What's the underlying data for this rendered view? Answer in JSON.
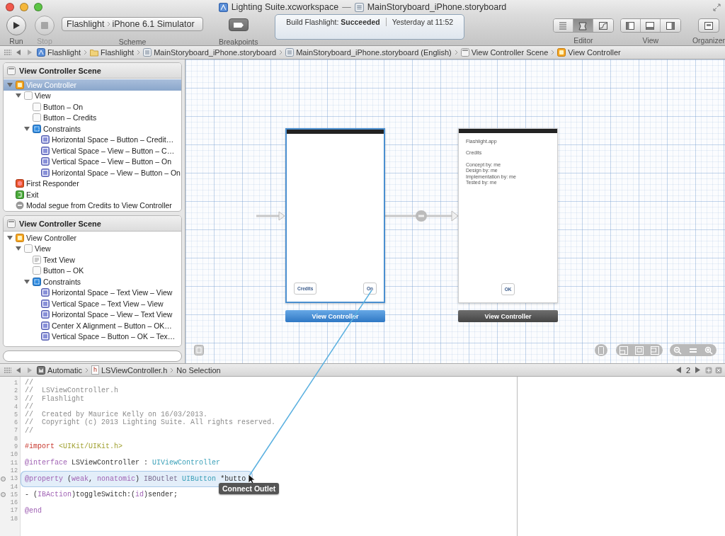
{
  "window": {
    "title": "Lighting Suite.xcworkspace",
    "separator": "—",
    "document": "MainStoryboard_iPhone.storyboard"
  },
  "toolbar": {
    "run": "Run",
    "stop": "Stop",
    "scheme": {
      "target": "Flashlight",
      "device": "iPhone 6.1 Simulator",
      "label": "Scheme"
    },
    "breakpoints": "Breakpoints",
    "activity": {
      "text": "Build Flashlight: **Succeeded**",
      "time": "Yesterday at 11:52"
    },
    "editor": {
      "label": "Editor",
      "segments": [
        {
          "kind": "standard",
          "selected": false
        },
        {
          "kind": "assistant",
          "selected": true
        },
        {
          "kind": "version",
          "selected": false
        }
      ]
    },
    "view": {
      "label": "View",
      "segments": [
        {
          "kind": "left"
        },
        {
          "kind": "bottom"
        },
        {
          "kind": "right"
        }
      ]
    },
    "organizer": "Organizer"
  },
  "jump_bar": [
    {
      "kind": "project",
      "label": "Flashlight"
    },
    {
      "kind": "folder",
      "label": "Flashlight"
    },
    {
      "kind": "storyboard",
      "label": "MainStoryboard_iPhone.storyboard"
    },
    {
      "kind": "storyboard",
      "label": "MainStoryboard_iPhone.storyboard (English)"
    },
    {
      "kind": "scene",
      "label": "View Controller Scene"
    },
    {
      "kind": "controller",
      "label": "View Controller"
    }
  ],
  "outline": [
    {
      "title": "View Controller Scene",
      "items": [
        {
          "kind": "controller",
          "label": "View Controller",
          "selected": true,
          "expanded": true,
          "children": [
            {
              "kind": "view",
              "label": "View",
              "selected": false,
              "expanded": true,
              "children": [
                {
                  "kind": "button",
                  "label": "Button – On",
                  "selected": false
                },
                {
                  "kind": "button",
                  "label": "Button – Credits",
                  "selected": false
                },
                {
                  "kind": "constraints",
                  "label": "Constraints",
                  "selected": false,
                  "expanded": true,
                  "children": [
                    {
                      "kind": "constraint",
                      "label": "Horizontal Space – Button – Credit…",
                      "selected": false
                    },
                    {
                      "kind": "constraint",
                      "label": "Vertical Space – View – Button – C…",
                      "selected": false
                    },
                    {
                      "kind": "constraint",
                      "label": "Vertical Space – View – Button – On",
                      "selected": false
                    },
                    {
                      "kind": "constraint",
                      "label": "Horizontal Space – View – Button – On",
                      "selected": false
                    }
                  ]
                }
              ]
            }
          ]
        },
        {
          "kind": "responder",
          "label": "First Responder",
          "selected": false
        },
        {
          "kind": "exit",
          "label": "Exit",
          "selected": false
        },
        {
          "kind": "segue",
          "label": "Modal segue from Credits to View Controller",
          "selected": false
        }
      ]
    },
    {
      "title": "View Controller Scene",
      "items": [
        {
          "kind": "controller",
          "label": "View Controller",
          "selected": false,
          "expanded": true,
          "children": [
            {
              "kind": "view",
              "label": "View",
              "selected": false,
              "expanded": true,
              "children": [
                {
                  "kind": "textview",
                  "label": "Text View",
                  "selected": false
                },
                {
                  "kind": "button",
                  "label": "Button – OK",
                  "selected": false
                },
                {
                  "kind": "constraints",
                  "label": "Constraints",
                  "selected": false,
                  "expanded": true,
                  "children": [
                    {
                      "kind": "constraint",
                      "label": "Horizontal Space – Text View – View",
                      "selected": false
                    },
                    {
                      "kind": "constraint",
                      "label": "Vertical Space – Text View – View",
                      "selected": false
                    },
                    {
                      "kind": "constraint",
                      "label": "Horizontal Space – View – Text View",
                      "selected": false
                    },
                    {
                      "kind": "constraint",
                      "label": "Center X Alignment – Button – OK…",
                      "selected": false
                    },
                    {
                      "kind": "constraint",
                      "label": "Vertical Space – Button – OK – Tex…",
                      "selected": false
                    }
                  ]
                }
              ]
            }
          ]
        }
      ]
    }
  ],
  "canvas": {
    "scenes": [
      {
        "title": "View Controller",
        "selected": true,
        "buttons": [
          "Credits",
          "On"
        ]
      },
      {
        "title": "View Controller",
        "selected": false,
        "texts": [
          "Flashlight.app",
          "Credits",
          "Concept by: me\nDesign by: me\nImplementation by: me\nTested by: me"
        ],
        "buttons": [
          "OK"
        ]
      }
    ]
  },
  "assistant_bar": {
    "crumbs": [
      {
        "kind": "automatic",
        "label": "Automatic"
      },
      {
        "kind": "header",
        "badge": "h",
        "label": "LSViewController.h"
      },
      {
        "kind": "plain",
        "label": "No Selection"
      }
    ],
    "counter": "2"
  },
  "code": [
    {
      "number": "1",
      "connector": false,
      "highlighted": false,
      "tokens": [
        {
          "kind": "comment",
          "text": "//"
        }
      ]
    },
    {
      "number": "2",
      "connector": false,
      "highlighted": false,
      "tokens": [
        {
          "kind": "comment",
          "text": "//  LSViewController.h"
        }
      ]
    },
    {
      "number": "3",
      "connector": false,
      "highlighted": false,
      "tokens": [
        {
          "kind": "comment",
          "text": "//  Flashlight"
        }
      ]
    },
    {
      "number": "4",
      "connector": false,
      "highlighted": false,
      "tokens": [
        {
          "kind": "comment",
          "text": "//"
        }
      ]
    },
    {
      "number": "5",
      "connector": false,
      "highlighted": false,
      "tokens": [
        {
          "kind": "comment",
          "text": "//  Created by Maurice Kelly on 16/03/2013."
        }
      ]
    },
    {
      "number": "6",
      "connector": false,
      "highlighted": false,
      "tokens": [
        {
          "kind": "comment",
          "text": "//  Copyright (c) 2013 Lighting Suite. All rights reserved."
        }
      ]
    },
    {
      "number": "7",
      "connector": false,
      "highlighted": false,
      "tokens": [
        {
          "kind": "comment",
          "text": "//"
        }
      ]
    },
    {
      "number": "8",
      "connector": false,
      "highlighted": false
    },
    {
      "number": "9",
      "connector": false,
      "highlighted": false,
      "tokens": [
        {
          "kind": "preproc",
          "text": "#import "
        },
        {
          "kind": "string",
          "text": "<UIKit/UIKit.h>"
        }
      ]
    },
    {
      "number": "10",
      "connector": false,
      "highlighted": false
    },
    {
      "number": "11",
      "connector": false,
      "highlighted": false,
      "tokens": [
        {
          "kind": "keyword",
          "text": "@interface"
        },
        {
          "kind": "plain",
          "text": " LSViewController : "
        },
        {
          "kind": "type",
          "text": "UIViewController"
        }
      ]
    },
    {
      "number": "12",
      "connector": false,
      "highlighted": false
    },
    {
      "number": "13",
      "connector": true,
      "highlighted": true,
      "tokens": [
        {
          "kind": "keyword",
          "text": "@property"
        },
        {
          "kind": "plain",
          "text": " ("
        },
        {
          "kind": "keyword",
          "text": "weak"
        },
        {
          "kind": "plain",
          "text": ", "
        },
        {
          "kind": "keyword",
          "text": "nonatomic"
        },
        {
          "kind": "plain",
          "text": ") "
        },
        {
          "kind": "macro",
          "text": "IBOutlet"
        },
        {
          "kind": "type",
          "text": " UIButton"
        },
        {
          "kind": "plain",
          "text": " *butto"
        }
      ]
    },
    {
      "number": "14",
      "connector": false,
      "highlighted": false
    },
    {
      "number": "15",
      "connector": true,
      "highlighted": false,
      "tokens": [
        {
          "kind": "plain",
          "text": "- ("
        },
        {
          "kind": "keyword",
          "text": "IBAction"
        },
        {
          "kind": "plain",
          "text": ")toggleSwitch:("
        },
        {
          "kind": "keyword",
          "text": "id"
        },
        {
          "kind": "plain",
          "text": ")sender;"
        }
      ]
    },
    {
      "number": "16",
      "connector": false,
      "highlighted": false
    },
    {
      "number": "17",
      "connector": false,
      "highlighted": false,
      "tokens": [
        {
          "kind": "keyword",
          "text": "@end"
        }
      ]
    },
    {
      "number": "18",
      "connector": false,
      "highlighted": false
    }
  ],
  "tooltip": "Connect Outlet"
}
